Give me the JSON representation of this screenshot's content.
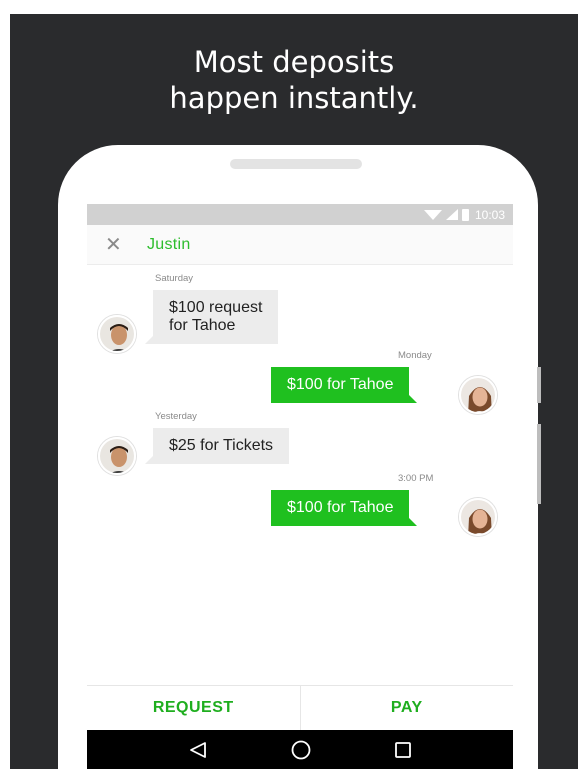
{
  "headline": {
    "line1": "Most deposits",
    "line2": "happen instantly."
  },
  "status_bar": {
    "time": "10:03"
  },
  "conversation": {
    "contact_name": "Justin",
    "messages": [
      {
        "timestamp": "Saturday",
        "direction": "incoming",
        "text_line1": "$100 request",
        "text_line2": "for Tahoe"
      },
      {
        "timestamp": "Monday",
        "direction": "outgoing",
        "text": "$100 for Tahoe"
      },
      {
        "timestamp": "Yesterday",
        "direction": "incoming",
        "text": "$25 for Tickets"
      },
      {
        "timestamp": "3:00 PM",
        "direction": "outgoing",
        "text": "$100 for Tahoe"
      }
    ]
  },
  "actions": {
    "request_label": "REQUEST",
    "pay_label": "PAY"
  },
  "colors": {
    "brand_green": "#1fc01f",
    "background_dark": "#2a2b2d",
    "incoming_bubble": "#ececec"
  },
  "icons": {
    "close": "close-icon",
    "back": "back-triangle-icon",
    "home": "home-circle-icon",
    "recents": "recents-square-icon"
  }
}
